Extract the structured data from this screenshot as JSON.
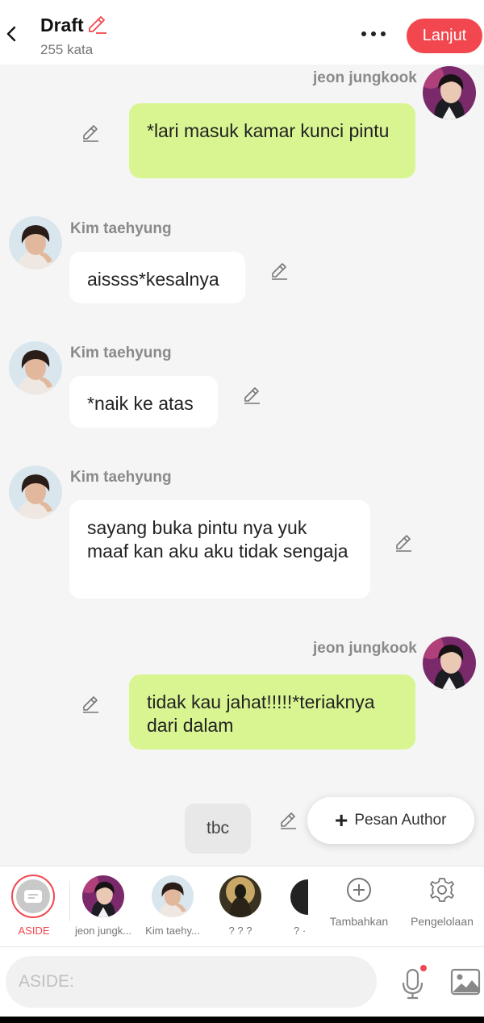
{
  "header": {
    "title": "Draft",
    "word_count": "255 kata",
    "next_label": "Lanjut"
  },
  "messages": [
    {
      "name": "jeon jungkook",
      "text": "*lari masuk kamar kunci pintu"
    },
    {
      "name": "Kim taehyung",
      "text": "aissss*kesalnya"
    },
    {
      "name": "Kim taehyung",
      "text": "*naik ke atas"
    },
    {
      "name": "Kim taehyung",
      "text": "sayang buka pintu nya yuk maaf kan aku aku tidak sengaja"
    },
    {
      "name": "jeon jungkook",
      "text": "tidak kau jahat!!!!!*teriaknya dari dalam"
    }
  ],
  "narration": {
    "text": "tbc"
  },
  "author_button": {
    "label": "Pesan Author"
  },
  "character_bar": {
    "items": [
      {
        "label": "ASIDE"
      },
      {
        "label": "jeon jungk..."
      },
      {
        "label": "Kim taehy..."
      },
      {
        "label": "? ? ?"
      },
      {
        "label": "? ·"
      }
    ],
    "add_label": "Tambahkan",
    "manage_label": "Pengelolaan"
  },
  "input": {
    "placeholder": "ASIDE:"
  },
  "colors": {
    "accent": "#f2474e",
    "bubble_self": "#d9f592",
    "bubble_other": "#ffffff",
    "background": "#f5f5f5"
  }
}
